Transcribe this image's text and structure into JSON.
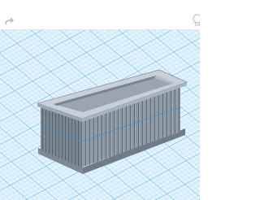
{
  "toolbar": {
    "redo_icon": "redo-arrow-icon",
    "hint_icon": "lightbulb-icon"
  },
  "workplane": {
    "grid_color": "#7ec5ec",
    "grid_major_color": "#4aa7df",
    "background": "#dff1fb"
  },
  "model": {
    "shape": "rectangular planter box with vertical ribs",
    "body_color": "#8e9aa6",
    "shade_color": "#6f7b87",
    "highlight_color": "#c7d0d8",
    "selection_edge_color": "#3d8fd6"
  }
}
